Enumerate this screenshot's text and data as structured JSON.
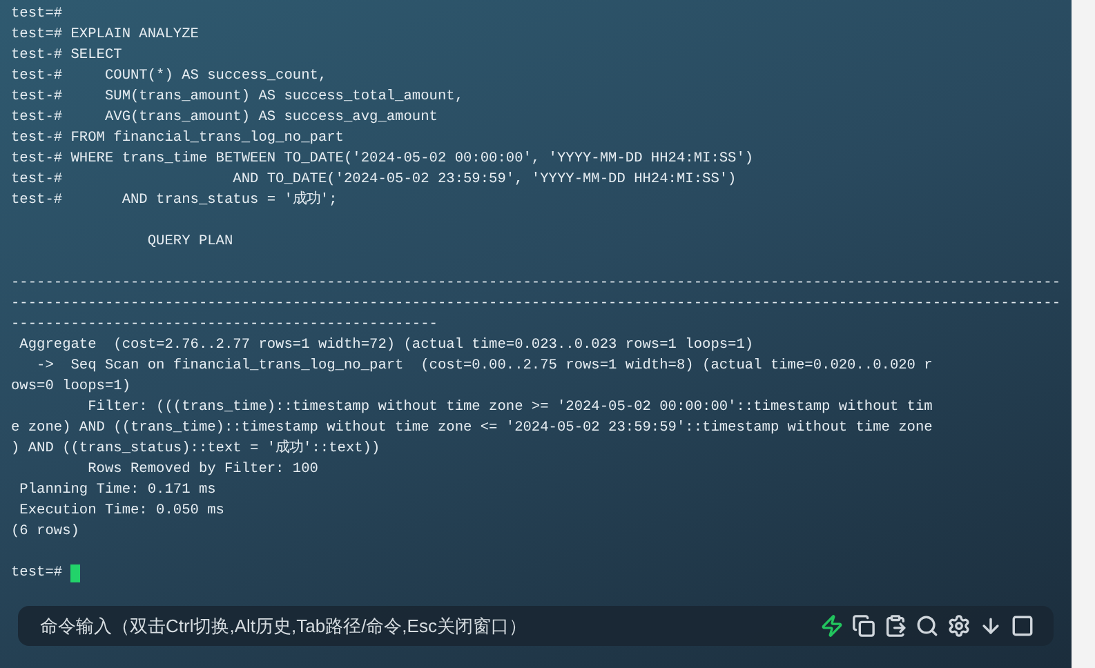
{
  "terminal": {
    "blocks": [
      [
        "test=#",
        "test=# EXPLAIN ANALYZE",
        "test-# SELECT",
        "test-#     COUNT(*) AS success_count,",
        "test-#     SUM(trans_amount) AS success_total_amount,",
        "test-#     AVG(trans_amount) AS success_avg_amount",
        "test-# FROM financial_trans_log_no_part",
        "test-# WHERE trans_time BETWEEN TO_DATE('2024-05-02 00:00:00', 'YYYY-MM-DD HH24:MI:SS')",
        "test-#                    AND TO_DATE('2024-05-02 23:59:59', 'YYYY-MM-DD HH24:MI:SS')",
        "test-#       AND trans_status = '成功';"
      ],
      [
        "                QUERY PLAN"
      ],
      [
        "---------------------------------------------------------------------------------------------------------------------------",
        "---------------------------------------------------------------------------------------------------------------------------",
        "--------------------------------------------------",
        " Aggregate  (cost=2.76..2.77 rows=1 width=72) (actual time=0.023..0.023 rows=1 loops=1)",
        "   ->  Seq Scan on financial_trans_log_no_part  (cost=0.00..2.75 rows=1 width=8) (actual time=0.020..0.020 r",
        "ows=0 loops=1)",
        "         Filter: (((trans_time)::timestamp without time zone >= '2024-05-02 00:00:00'::timestamp without tim",
        "e zone) AND ((trans_time)::timestamp without time zone <= '2024-05-02 23:59:59'::timestamp without time zone",
        ") AND ((trans_status)::text = '成功'::text))",
        "         Rows Removed by Filter: 100",
        " Planning Time: 0.171 ms",
        " Execution Time: 0.050 ms",
        "(6 rows)"
      ]
    ],
    "prompt": "test=#"
  },
  "command_bar": {
    "placeholder": "命令输入（双击Ctrl切换,Alt历史,Tab路径/命令,Esc关闭窗口）"
  }
}
